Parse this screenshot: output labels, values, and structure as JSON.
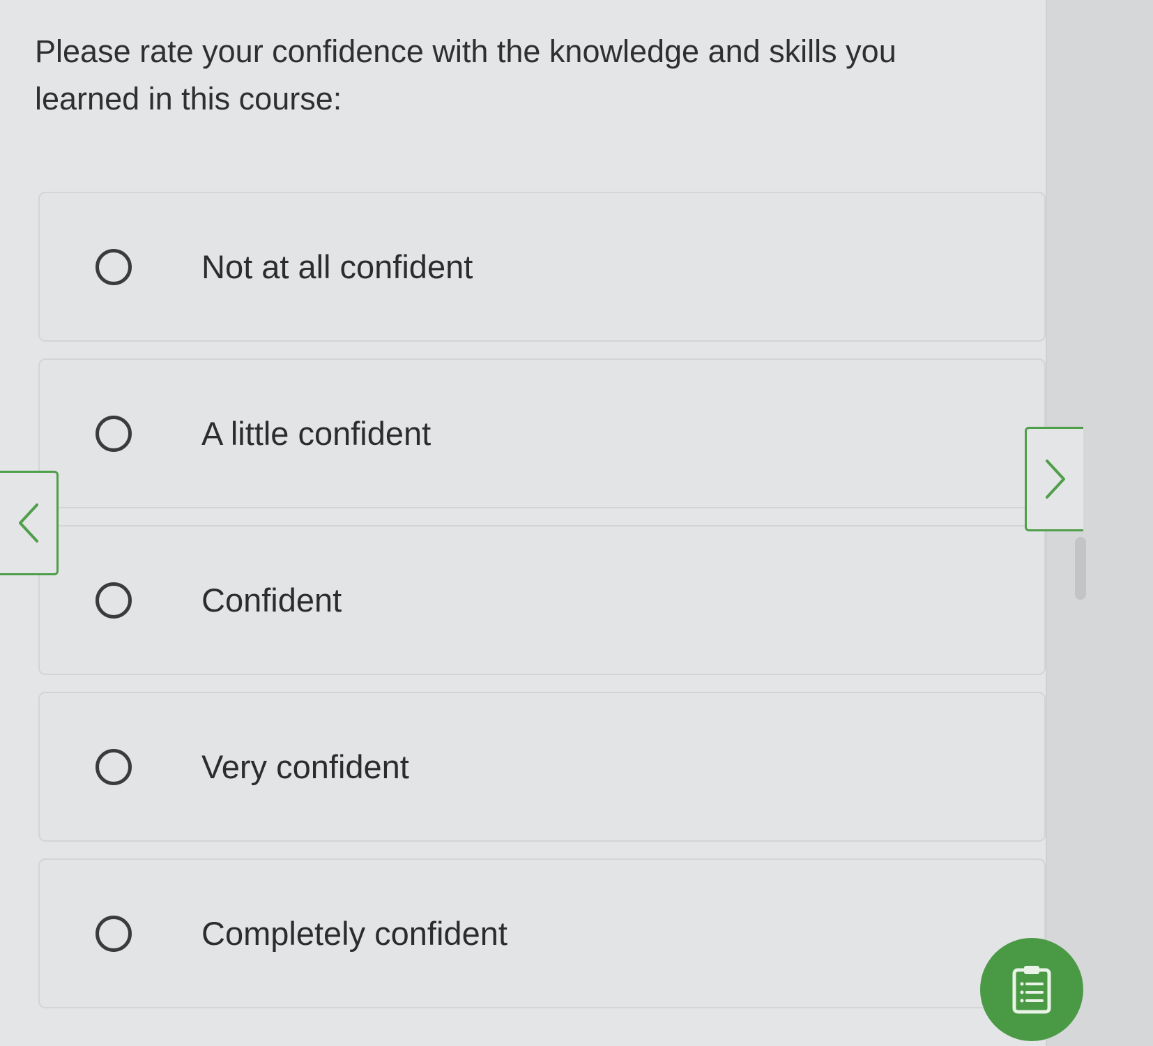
{
  "question": {
    "text": "Please rate your confidence with the knowledge and skills you learned in this course:"
  },
  "options": [
    {
      "label": "Not at all confident"
    },
    {
      "label": "A little confident"
    },
    {
      "label": "Confident"
    },
    {
      "label": "Very confident"
    },
    {
      "label": "Completely confident"
    }
  ],
  "navigation": {
    "prev_icon": "chevron-left-icon",
    "next_icon": "chevron-right-icon"
  },
  "fab": {
    "icon": "clipboard-list-icon"
  },
  "colors": {
    "accent": "#4f9e4a",
    "fab": "#4a9a45",
    "background": "#e4e5e7",
    "text": "#2e2f31"
  }
}
